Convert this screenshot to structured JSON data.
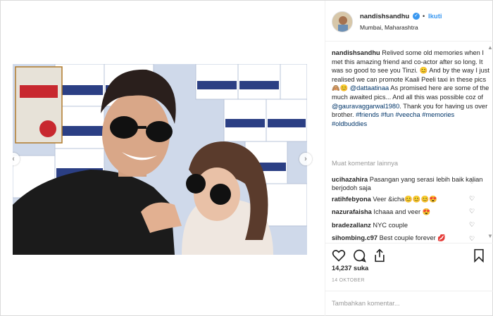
{
  "header": {
    "username": "nandishsandhu",
    "follow_label": "Ikuti",
    "dot": "•",
    "location": "Mumbai, Maharashtra"
  },
  "caption": {
    "username": "nandishsandhu",
    "text_1": " Relived some old memories when I met this amazing friend and co-actor after so long. It was so good to see you Tinzi. 😊 And by the way I just realised we can promote Kaali Peeli taxi in these pics 🙈😊 ",
    "mention_1": "@dattaatinaa",
    "text_2": " As promised here are some of the much awaited pics... And all this was possible coz of ",
    "mention_2": "@gauravaggarwal1980",
    "text_3": ". Thank you for having us over brother. ",
    "hashtags": "#friends #fun #veecha #memories #oldbuddies"
  },
  "load_more_label": "Muat komentar lainnya",
  "comments": [
    {
      "user": "ucihazahira",
      "text": " Pasangan yang serasi lebih baik kalian berjodoh saja"
    },
    {
      "user": "ratihfebyona",
      "text": " Veer &icha😊😊😊😍"
    },
    {
      "user": "nazurafaisha",
      "text": " Ichaaa and veer 😍"
    },
    {
      "user": "bradezallanz",
      "text": " NYC couple"
    },
    {
      "user": "sihombing.c97",
      "text": " Best couple forever 💋"
    }
  ],
  "likes": "14,237 suka",
  "date": "14 OKTOBER",
  "add_comment_placeholder": "Tambahkan komentar...",
  "colors": {
    "accent": "#3897f0",
    "link": "#003569",
    "text": "#262626",
    "muted": "#999999"
  },
  "icons": [
    "heart-icon",
    "comment-icon",
    "share-icon",
    "bookmark-icon",
    "verified-badge-icon",
    "chevron-left-icon",
    "chevron-right-icon"
  ]
}
